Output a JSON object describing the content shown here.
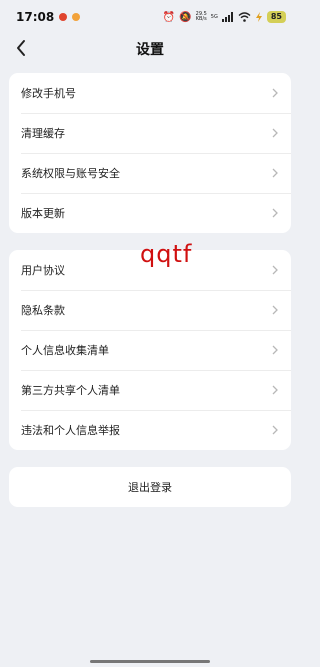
{
  "status_bar": {
    "time": "17:08",
    "net_speed_value": "29.5",
    "net_speed_unit": "KB/s",
    "network_type": "5G",
    "battery": "85"
  },
  "nav": {
    "title": "设置",
    "back_icon": "chevron-left-icon"
  },
  "group1": [
    {
      "label": "修改手机号"
    },
    {
      "label": "清理缓存"
    },
    {
      "label": "系统权限与账号安全"
    },
    {
      "label": "版本更新"
    }
  ],
  "group2": [
    {
      "label": "用户协议"
    },
    {
      "label": "隐私条款"
    },
    {
      "label": "个人信息收集清单"
    },
    {
      "label": "第三方共享个人清单"
    },
    {
      "label": "违法和个人信息举报"
    }
  ],
  "logout_label": "退出登录",
  "watermark": "qqtf",
  "colors": {
    "background": "#eef0f4",
    "card": "#ffffff",
    "watermark": "#d01010",
    "battery": "#d4cf57"
  }
}
